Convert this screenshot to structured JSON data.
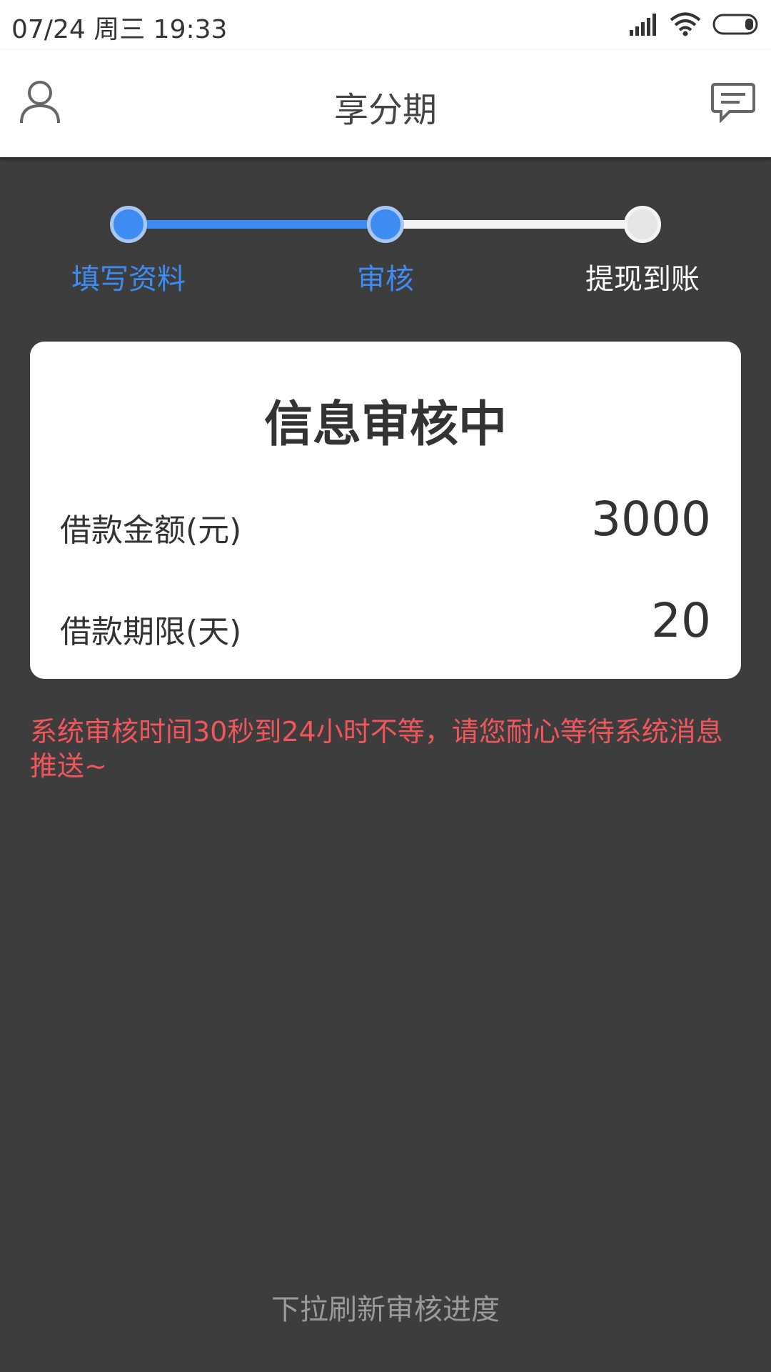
{
  "status_bar": {
    "date": "07/24",
    "weekday": "周三",
    "time": "19:33"
  },
  "header": {
    "title": "享分期",
    "left_icon": "user-icon",
    "right_icon": "message-icon"
  },
  "steps": [
    {
      "label": "填写资料",
      "state": "done"
    },
    {
      "label": "审核",
      "state": "current"
    },
    {
      "label": "提现到账",
      "state": "pending"
    }
  ],
  "card": {
    "title": "信息审核中",
    "amount_label": "借款金额(元)",
    "amount_value": "3000",
    "term_label": "借款期限(天)",
    "term_value": "20"
  },
  "notice": "系统审核时间30秒到24小时不等，请您耐心等待系统消息推送~",
  "footer_hint": "下拉刷新审核进度",
  "colors": {
    "accent": "#3e8bf2",
    "notice": "#f0565b",
    "background": "#3d3d3d"
  }
}
